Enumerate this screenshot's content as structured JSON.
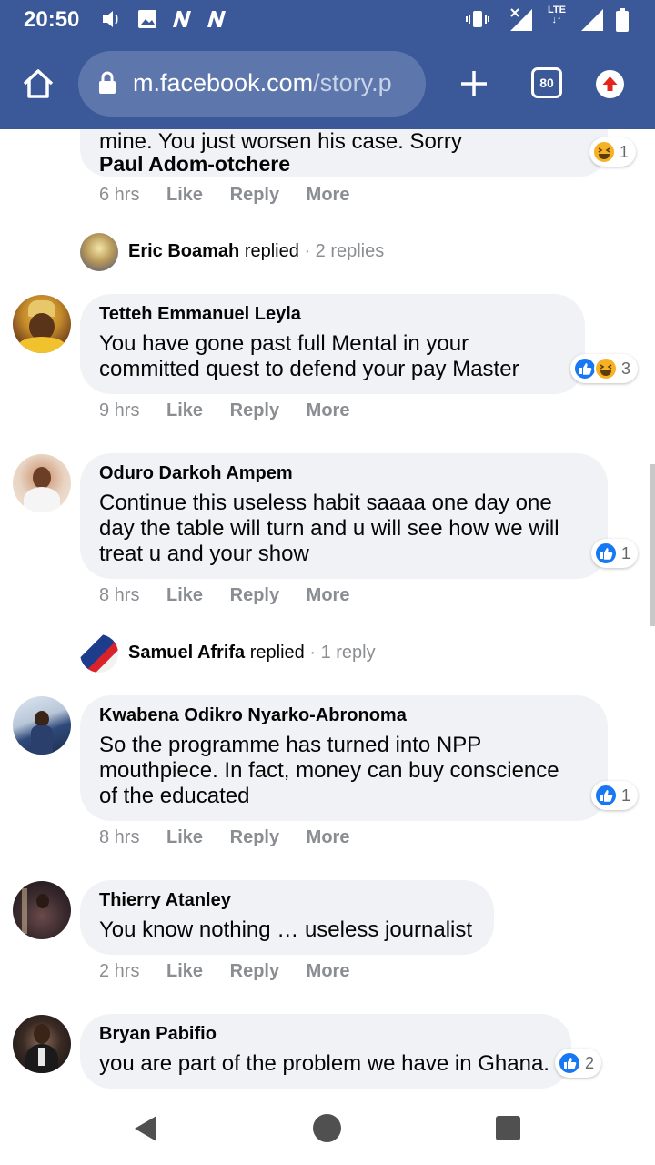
{
  "status_bar": {
    "time": "20:50",
    "network": "LTE",
    "icons": [
      "volume-icon",
      "image-icon",
      "n-notification-icon",
      "n-notification-icon",
      "vibrate-icon",
      "no-signal-icon",
      "signal-icon",
      "battery-icon"
    ]
  },
  "browser": {
    "url_host": "m.facebook.com",
    "url_path": "/story.p",
    "tab_count": "80",
    "toolbar_color": "#3b5998"
  },
  "comments": [
    {
      "name": "Paul Adom-otchere",
      "text_cut": "mine. You just worsen his case. Sorry",
      "time": "6 hrs",
      "like": "Like",
      "reply": "Reply",
      "more": "More",
      "reactions": [
        "haha"
      ],
      "reaction_count": "1"
    },
    {
      "name": "Tetteh Emmanuel Leyla",
      "text": "You have gone past full Mental in your\ncommitted quest to defend your pay Master",
      "time": "9 hrs",
      "like": "Like",
      "reply": "Reply",
      "more": "More",
      "reactions": [
        "like",
        "haha"
      ],
      "reaction_count": "3"
    },
    {
      "name": "Oduro Darkoh Ampem",
      "text": "Continue this useless habit saaaa one day one\nday the table will turn and u will see how we will\ntreat u and your show",
      "time": "8 hrs",
      "like": "Like",
      "reply": "Reply",
      "more": "More",
      "reactions": [
        "like"
      ],
      "reaction_count": "1"
    },
    {
      "name": "Kwabena Odikro Nyarko-Abronoma",
      "text": "So the programme has turned into NPP\nmouthpiece. In fact, money can buy conscience\nof the educated",
      "time": "8 hrs",
      "like": "Like",
      "reply": "Reply",
      "more": "More",
      "reactions": [
        "like"
      ],
      "reaction_count": "1"
    },
    {
      "name": "Thierry Atanley",
      "text": "You know nothing … useless journalist",
      "time": "2 hrs",
      "like": "Like",
      "reply": "Reply",
      "more": "More"
    },
    {
      "name": "Bryan Pabifio",
      "text": "you are part of the problem we have in Ghana.",
      "reactions": [
        "like"
      ],
      "reaction_count": "2"
    }
  ],
  "replies": [
    {
      "name": "Eric Boamah",
      "verb": "replied",
      "count": "· 2 replies"
    },
    {
      "name": "Samuel Afrifa",
      "verb": "replied",
      "count": "· 1 reply"
    }
  ],
  "nav": {
    "icons": [
      "back-icon",
      "home-icon",
      "recents-icon"
    ]
  }
}
